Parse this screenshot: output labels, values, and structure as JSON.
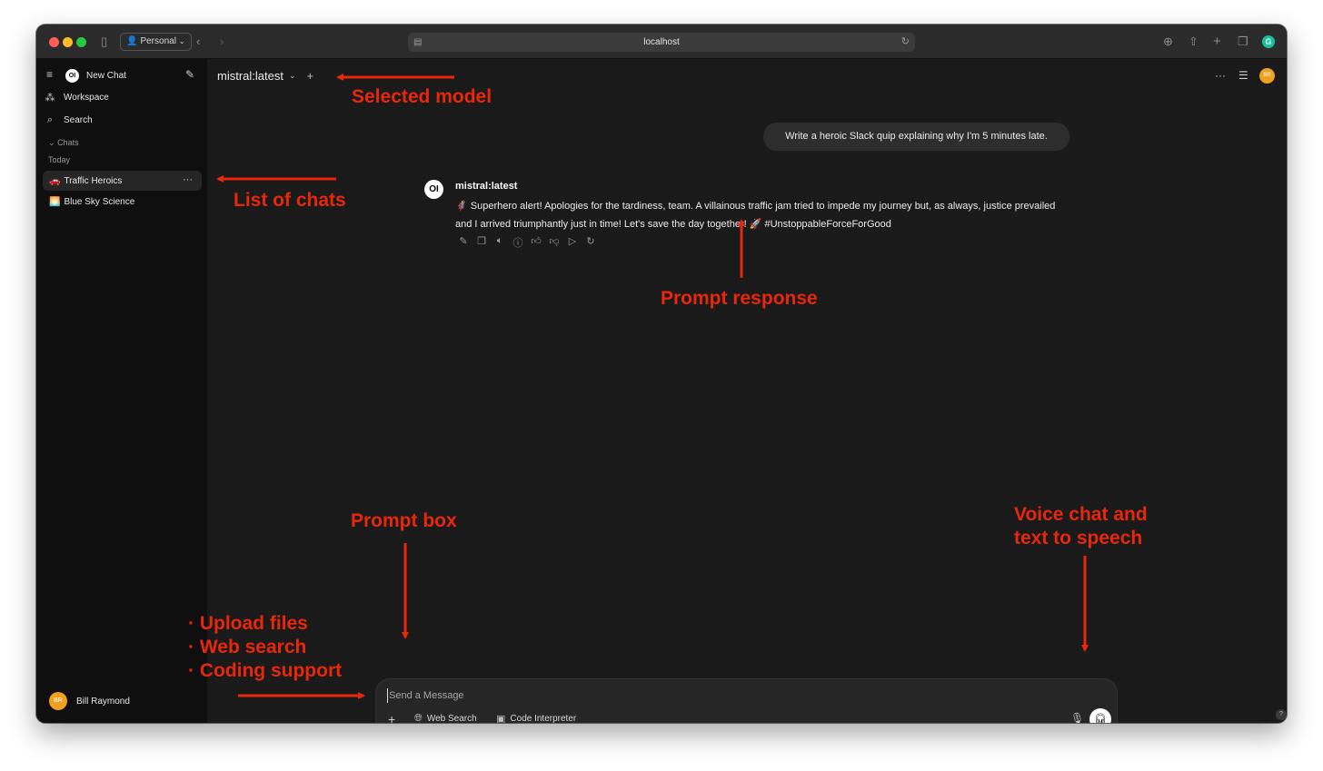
{
  "browser": {
    "profile_label": "Personal",
    "url": "localhost"
  },
  "sidebar": {
    "new_chat_label": "New Chat",
    "workspace_label": "Workspace",
    "search_label": "Search",
    "chats_section_label": "Chats",
    "today_label": "Today",
    "chats": [
      {
        "emoji": "🚗",
        "title": "Traffic Heroics"
      },
      {
        "emoji": "🌅",
        "title": "Blue Sky Science"
      }
    ],
    "user": {
      "initials": "BR",
      "name": "Bill Raymond"
    }
  },
  "header": {
    "model_name": "mistral:latest",
    "user_initials": "BR"
  },
  "conversation": {
    "user_message": "Write a heroic Slack quip explaining why I'm 5 minutes late.",
    "assistant_logo": "OI",
    "assistant_name": "mistral:latest",
    "assistant_message": "🦸 Superhero alert! Apologies for the tardiness, team. A villainous traffic jam tried to impede my journey but, as always, justice prevailed and I arrived triumphantly just in time! Let's save the day together! 🚀 #UnstoppableForceForGood"
  },
  "prompt": {
    "placeholder": "Send a Message",
    "web_search_label": "Web Search",
    "code_interpreter_label": "Code Interpreter"
  },
  "annotations": {
    "selected_model": "Selected model",
    "list_of_chats": "List of chats",
    "prompt_response": "Prompt response",
    "prompt_box": "Prompt box",
    "voice_chat_line1": "Voice chat and",
    "voice_chat_line2": "text to speech",
    "upload_files": "Upload files",
    "web_search": "Web search",
    "coding_support": "Coding support",
    "color": "#e8270c"
  },
  "colors": {
    "sidebar_bg": "#0f0f0f",
    "main_bg": "#1a1a1a",
    "avatar": "#f0a020",
    "traffic_close": "#ff5f57",
    "traffic_min": "#febc2e",
    "traffic_max": "#28c840"
  }
}
